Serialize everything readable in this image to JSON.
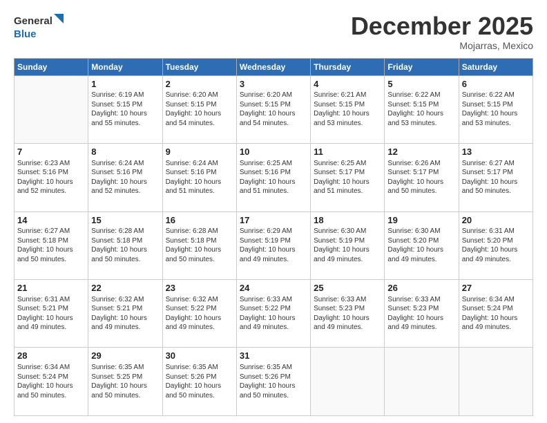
{
  "header": {
    "logo_line1": "General",
    "logo_line2": "Blue",
    "month": "December 2025",
    "location": "Mojarras, Mexico"
  },
  "weekdays": [
    "Sunday",
    "Monday",
    "Tuesday",
    "Wednesday",
    "Thursday",
    "Friday",
    "Saturday"
  ],
  "weeks": [
    [
      {
        "day": "",
        "info": ""
      },
      {
        "day": "1",
        "info": "Sunrise: 6:19 AM\nSunset: 5:15 PM\nDaylight: 10 hours\nand 55 minutes."
      },
      {
        "day": "2",
        "info": "Sunrise: 6:20 AM\nSunset: 5:15 PM\nDaylight: 10 hours\nand 54 minutes."
      },
      {
        "day": "3",
        "info": "Sunrise: 6:20 AM\nSunset: 5:15 PM\nDaylight: 10 hours\nand 54 minutes."
      },
      {
        "day": "4",
        "info": "Sunrise: 6:21 AM\nSunset: 5:15 PM\nDaylight: 10 hours\nand 53 minutes."
      },
      {
        "day": "5",
        "info": "Sunrise: 6:22 AM\nSunset: 5:15 PM\nDaylight: 10 hours\nand 53 minutes."
      },
      {
        "day": "6",
        "info": "Sunrise: 6:22 AM\nSunset: 5:15 PM\nDaylight: 10 hours\nand 53 minutes."
      }
    ],
    [
      {
        "day": "7",
        "info": "Sunrise: 6:23 AM\nSunset: 5:16 PM\nDaylight: 10 hours\nand 52 minutes."
      },
      {
        "day": "8",
        "info": "Sunrise: 6:24 AM\nSunset: 5:16 PM\nDaylight: 10 hours\nand 52 minutes."
      },
      {
        "day": "9",
        "info": "Sunrise: 6:24 AM\nSunset: 5:16 PM\nDaylight: 10 hours\nand 51 minutes."
      },
      {
        "day": "10",
        "info": "Sunrise: 6:25 AM\nSunset: 5:16 PM\nDaylight: 10 hours\nand 51 minutes."
      },
      {
        "day": "11",
        "info": "Sunrise: 6:25 AM\nSunset: 5:17 PM\nDaylight: 10 hours\nand 51 minutes."
      },
      {
        "day": "12",
        "info": "Sunrise: 6:26 AM\nSunset: 5:17 PM\nDaylight: 10 hours\nand 50 minutes."
      },
      {
        "day": "13",
        "info": "Sunrise: 6:27 AM\nSunset: 5:17 PM\nDaylight: 10 hours\nand 50 minutes."
      }
    ],
    [
      {
        "day": "14",
        "info": "Sunrise: 6:27 AM\nSunset: 5:18 PM\nDaylight: 10 hours\nand 50 minutes."
      },
      {
        "day": "15",
        "info": "Sunrise: 6:28 AM\nSunset: 5:18 PM\nDaylight: 10 hours\nand 50 minutes."
      },
      {
        "day": "16",
        "info": "Sunrise: 6:28 AM\nSunset: 5:18 PM\nDaylight: 10 hours\nand 50 minutes."
      },
      {
        "day": "17",
        "info": "Sunrise: 6:29 AM\nSunset: 5:19 PM\nDaylight: 10 hours\nand 49 minutes."
      },
      {
        "day": "18",
        "info": "Sunrise: 6:30 AM\nSunset: 5:19 PM\nDaylight: 10 hours\nand 49 minutes."
      },
      {
        "day": "19",
        "info": "Sunrise: 6:30 AM\nSunset: 5:20 PM\nDaylight: 10 hours\nand 49 minutes."
      },
      {
        "day": "20",
        "info": "Sunrise: 6:31 AM\nSunset: 5:20 PM\nDaylight: 10 hours\nand 49 minutes."
      }
    ],
    [
      {
        "day": "21",
        "info": "Sunrise: 6:31 AM\nSunset: 5:21 PM\nDaylight: 10 hours\nand 49 minutes."
      },
      {
        "day": "22",
        "info": "Sunrise: 6:32 AM\nSunset: 5:21 PM\nDaylight: 10 hours\nand 49 minutes."
      },
      {
        "day": "23",
        "info": "Sunrise: 6:32 AM\nSunset: 5:22 PM\nDaylight: 10 hours\nand 49 minutes."
      },
      {
        "day": "24",
        "info": "Sunrise: 6:33 AM\nSunset: 5:22 PM\nDaylight: 10 hours\nand 49 minutes."
      },
      {
        "day": "25",
        "info": "Sunrise: 6:33 AM\nSunset: 5:23 PM\nDaylight: 10 hours\nand 49 minutes."
      },
      {
        "day": "26",
        "info": "Sunrise: 6:33 AM\nSunset: 5:23 PM\nDaylight: 10 hours\nand 49 minutes."
      },
      {
        "day": "27",
        "info": "Sunrise: 6:34 AM\nSunset: 5:24 PM\nDaylight: 10 hours\nand 49 minutes."
      }
    ],
    [
      {
        "day": "28",
        "info": "Sunrise: 6:34 AM\nSunset: 5:24 PM\nDaylight: 10 hours\nand 50 minutes."
      },
      {
        "day": "29",
        "info": "Sunrise: 6:35 AM\nSunset: 5:25 PM\nDaylight: 10 hours\nand 50 minutes."
      },
      {
        "day": "30",
        "info": "Sunrise: 6:35 AM\nSunset: 5:26 PM\nDaylight: 10 hours\nand 50 minutes."
      },
      {
        "day": "31",
        "info": "Sunrise: 6:35 AM\nSunset: 5:26 PM\nDaylight: 10 hours\nand 50 minutes."
      },
      {
        "day": "",
        "info": ""
      },
      {
        "day": "",
        "info": ""
      },
      {
        "day": "",
        "info": ""
      }
    ]
  ]
}
